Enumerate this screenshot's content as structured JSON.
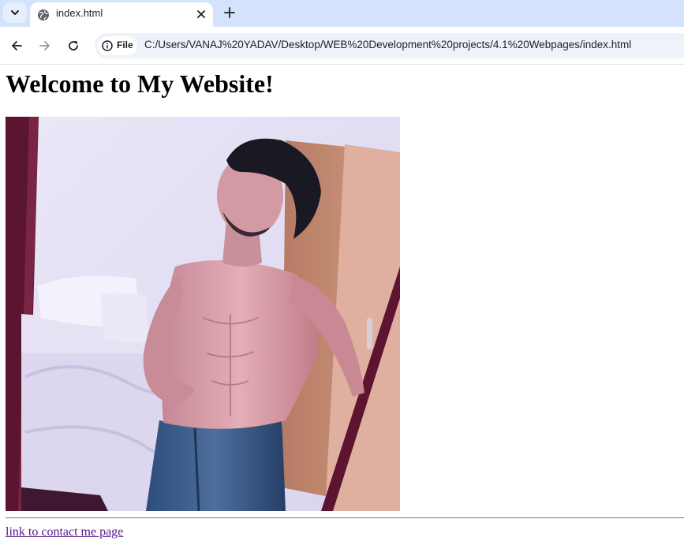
{
  "browser": {
    "tab": {
      "title": "index.html"
    },
    "omnibox": {
      "chip_label": "File",
      "url": "C:/Users/VANAJ%20YADAV/Desktop/WEB%20Development%20projects/4.1%20Webpages/index.html"
    },
    "colors": {
      "tabstrip": "#d3e3fd",
      "omnibox": "#eef2fa"
    },
    "icons": {
      "tab_list": "chevron-down-icon",
      "favicon": "globe-icon",
      "close": "close-icon",
      "new_tab": "plus-icon",
      "back": "arrow-left-icon",
      "forward": "arrow-right-icon",
      "reload": "reload-icon",
      "info": "info-icon"
    }
  },
  "page": {
    "heading": "Welcome to My Website!",
    "image": {
      "subject": "shirtless man posing in a bedroom with a wooden wardrobe door"
    },
    "link_text": "link to contact me page",
    "colors": {
      "visited_link": "#551a8b"
    }
  }
}
